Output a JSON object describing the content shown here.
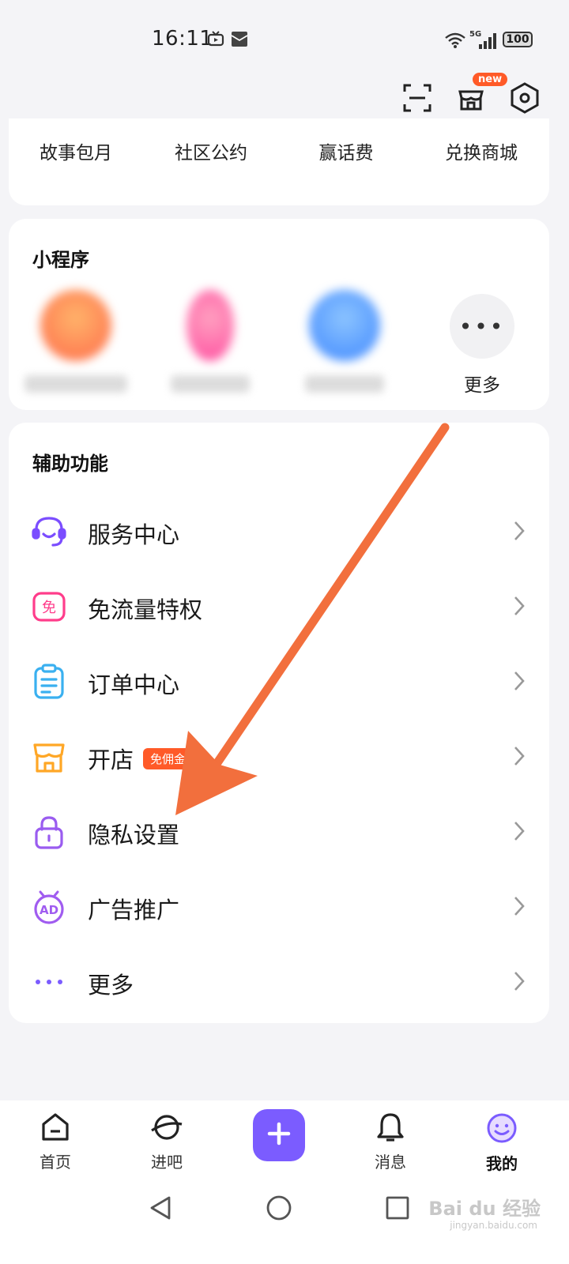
{
  "status_bar": {
    "time": "16:11",
    "battery": "100",
    "network": "5G"
  },
  "top_actions": {
    "new_badge": "new"
  },
  "quick_links": [
    "故事包月",
    "社区公约",
    "赢话费",
    "兑换商城"
  ],
  "mini_programs": {
    "title": "小程序",
    "more_label": "更多",
    "apps": [
      {
        "icon": "blurred-app-icon",
        "color": "#ff8a5c"
      },
      {
        "icon": "blurred-app-icon",
        "color": "#ff6aa8"
      },
      {
        "icon": "blurred-app-icon",
        "color": "#4d9bff"
      }
    ]
  },
  "assist": {
    "title": "辅助功能",
    "items": [
      {
        "label": "服务中心",
        "icon": "headset-icon",
        "color": "#7b4dff"
      },
      {
        "label": "免流量特权",
        "icon": "free-data-icon",
        "color": "#ff3d8b",
        "icon_text": "免"
      },
      {
        "label": "订单中心",
        "icon": "clipboard-icon",
        "color": "#3ab0f0"
      },
      {
        "label": "开店",
        "icon": "shop-icon",
        "color": "#ffa726",
        "tag": "免佣金"
      },
      {
        "label": "隐私设置",
        "icon": "lock-icon",
        "color": "#9a5cf0"
      },
      {
        "label": "广告推广",
        "icon": "ad-icon",
        "color": "#a05cf0",
        "icon_text": "AD"
      },
      {
        "label": "更多",
        "icon": "more-dots-icon",
        "color": "#7b5cff"
      }
    ]
  },
  "bottom_nav": {
    "items": [
      {
        "label": "首页",
        "icon": "home-icon"
      },
      {
        "label": "进吧",
        "icon": "planet-icon"
      },
      {
        "label": "",
        "icon": "plus-icon"
      },
      {
        "label": "消息",
        "icon": "bell-icon"
      },
      {
        "label": "我的",
        "icon": "smiley-icon",
        "active": true
      }
    ]
  },
  "annotation": {
    "arrow_color": "#f26f3d"
  },
  "watermark": {
    "text": "Bai du 经验",
    "sub": "jingyan.baidu.com"
  }
}
